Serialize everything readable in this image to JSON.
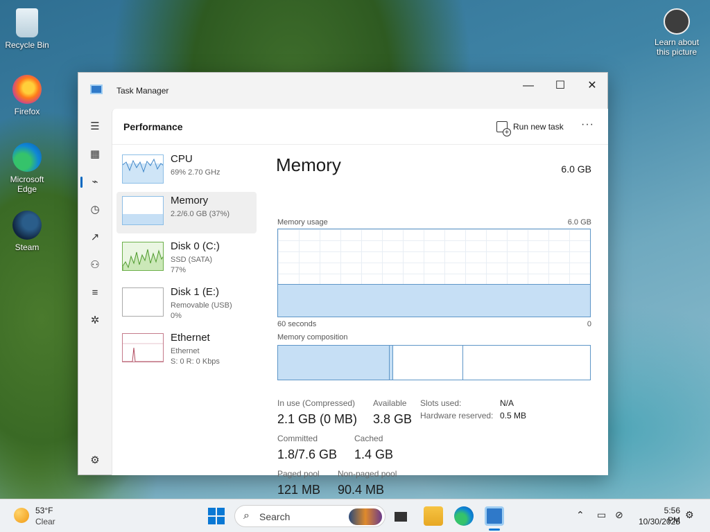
{
  "desktop": {
    "icons": [
      {
        "label": "Recycle Bin"
      },
      {
        "label": "Firefox"
      },
      {
        "label": "Microsoft Edge"
      },
      {
        "label": "Steam"
      }
    ],
    "learn_label": "Learn about this picture"
  },
  "window": {
    "title": "Task Manager",
    "controls": {
      "minimize": "—",
      "maximize": "☐",
      "close": "✕"
    }
  },
  "nav": {
    "icons": [
      "hamburger-menu-icon",
      "processes-icon",
      "performance-icon",
      "app-history-icon",
      "startup-apps-icon",
      "users-icon",
      "details-icon",
      "services-icon",
      "settings-icon"
    ],
    "active": "performance"
  },
  "header": {
    "page_title": "Performance",
    "run_new_task": "Run new task",
    "more": "···"
  },
  "resources": [
    {
      "name": "CPU",
      "sub1": "69% 2.70 GHz",
      "sub2": ""
    },
    {
      "name": "Memory",
      "sub1": "2.2/6.0 GB (37%)",
      "sub2": ""
    },
    {
      "name": "Disk 0 (C:)",
      "sub1": "SSD (SATA)",
      "sub2": "77%"
    },
    {
      "name": "Disk 1 (E:)",
      "sub1": "Removable (USB)",
      "sub2": "0%"
    },
    {
      "name": "Ethernet",
      "sub1": "Ethernet",
      "sub2": "S: 0 R: 0 Kbps"
    }
  ],
  "memory": {
    "title": "Memory",
    "total": "6.0 GB",
    "usage_label": "Memory usage",
    "usage_max": "6.0 GB",
    "time_left": "60 seconds",
    "time_right": "0",
    "usage_fraction": 0.37,
    "composition_label": "Memory composition",
    "stats": {
      "in_use_label": "In use (Compressed)",
      "in_use_value": "2.1 GB (0 MB)",
      "available_label": "Available",
      "available_value": "3.8 GB",
      "committed_label": "Committed",
      "committed_value": "1.8/7.6 GB",
      "cached_label": "Cached",
      "cached_value": "1.4 GB",
      "paged_label": "Paged pool",
      "paged_value": "121 MB",
      "nonpaged_label": "Non-paged pool",
      "nonpaged_value": "90.4 MB",
      "slots_label": "Slots used:",
      "slots_value": "N/A",
      "hw_label": "Hardware reserved:",
      "hw_value": "0.5 MB"
    }
  },
  "taskbar": {
    "weather_temp": "53°F",
    "weather_cond": "Clear",
    "search_placeholder": "Search",
    "time": "5:56 PM",
    "date": "10/30/2025"
  }
}
